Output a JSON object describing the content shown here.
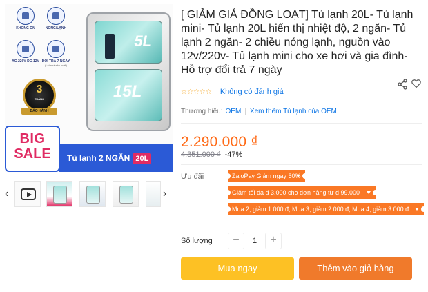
{
  "gallery": {
    "features": [
      {
        "label": "KHÔNG ỒN",
        "sub": ""
      },
      {
        "label": "NÓNG/LẠNH",
        "sub": ""
      },
      {
        "label": "AC-220V DC-12V",
        "sub": ""
      },
      {
        "label": "ĐỔI TRẢ 7 NGÀY",
        "sub": "(Lỗi nhà sản xuất)"
      }
    ],
    "fridge_top_label": "5L",
    "fridge_bottom_label": "15L",
    "badge_number": "3",
    "badge_small": "THÁNG",
    "badge_ribbon": "BẢO HÀNH",
    "sale_word1": "BIG",
    "sale_word2": "SALE",
    "strip_text": "Tủ lạnh 2 NGĂN",
    "strip_capacity": "20L"
  },
  "thumbnails": {
    "prev_arrow": "‹",
    "next_arrow": "›"
  },
  "product": {
    "title": "[ GIẢM GIÁ ĐỒNG LOẠT] Tủ lạnh 20L- Tủ lạnh mini- Tủ lạnh 20L hiển thị nhiệt độ, 2 ngăn- Tủ lạnh 2 ngăn- 2 chiều nóng lạnh, nguồn vào 12v/220v- Tủ lạnh mini cho xe hơi và gia đình- Hỗ trợ đổi trả 7 ngày",
    "stars": "☆☆☆☆☆",
    "no_review": "Không có đánh giá",
    "brand_label": "Thương hiệu:",
    "brand": "OEM",
    "see_more": "Xem thêm Tủ lạnh của OEM",
    "price": "2.290.000 ₫",
    "old_price": "4.351.000 ₫",
    "discount": "-47%"
  },
  "promotions": {
    "label": "Ưu đãi",
    "items": [
      "ZaloPay Giảm ngay 50%",
      "Giảm tối đa đ 3.000 cho đơn hàng từ đ 99.000",
      "Mua 2, giảm 1.000 đ; Mua 3, giảm 2.000 đ; Mua 4, giảm 3.000 đ"
    ]
  },
  "quantity": {
    "label": "Số lượng",
    "minus": "−",
    "value": "1",
    "plus": "+"
  },
  "actions": {
    "buy_now": "Mua ngay",
    "add_to_cart": "Thêm vào giỏ hàng"
  },
  "colors": {
    "price": "#ff6a16",
    "coupon": "#fa7825",
    "buy_now": "#fdc124",
    "add_to_cart": "#f07a2b",
    "link": "#0b74e5"
  }
}
